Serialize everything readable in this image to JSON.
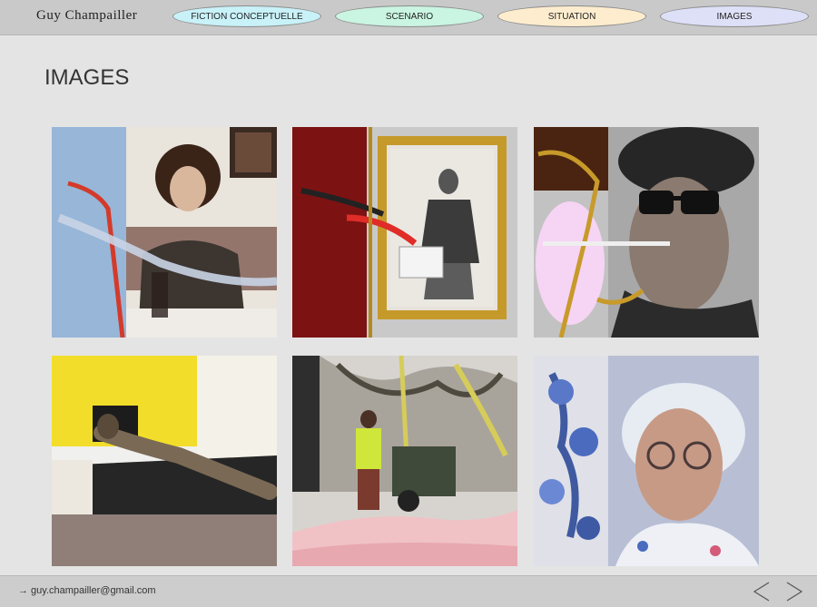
{
  "site": {
    "name": "Guy Champailler"
  },
  "nav": {
    "items": [
      {
        "label": "FICTION CONCEPTUELLE",
        "color": "#c8f1f8"
      },
      {
        "label": "SCENARIO",
        "color": "#c9f5e2"
      },
      {
        "label": "SITUATION",
        "color": "#fdedce"
      },
      {
        "label": "IMAGES",
        "color": "#dde0f7"
      }
    ]
  },
  "page": {
    "title": "IMAGES"
  },
  "gallery": {
    "images": [
      {
        "subject": "woman-with-curly-hair-and-wine-glass"
      },
      {
        "subject": "man-portrait-in-gold-frame"
      },
      {
        "subject": "man-with-sunglasses-and-hat"
      },
      {
        "subject": "figure-lying-on-bed"
      },
      {
        "subject": "street-worker-with-cart"
      },
      {
        "subject": "elderly-woman-with-flowers"
      }
    ]
  },
  "footer": {
    "email": "→ guy.champailler@gmail.com",
    "prev_icon": "chevron-left-icon",
    "next_icon": "chevron-right-icon"
  }
}
